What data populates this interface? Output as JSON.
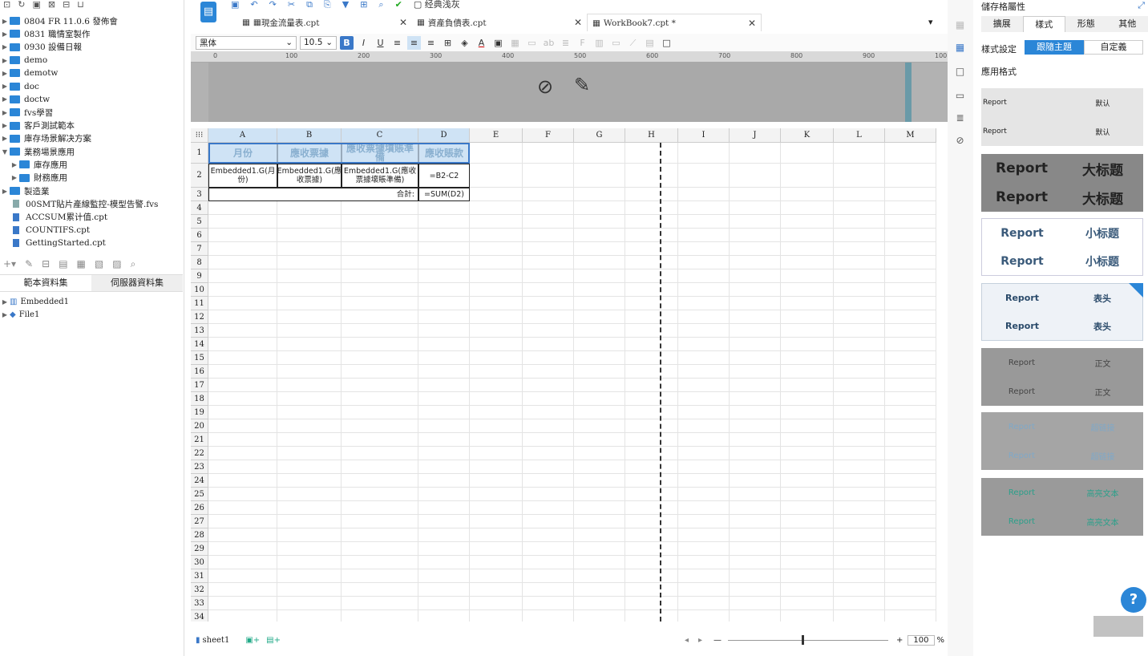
{
  "left_panel": {
    "tree": [
      {
        "label": "0804 FR 11.0.6 發佈會",
        "type": "folder"
      },
      {
        "label": "0831 職情室製作",
        "type": "folder"
      },
      {
        "label": "0930 設備日報",
        "type": "folder"
      },
      {
        "label": "demo",
        "type": "folder"
      },
      {
        "label": "demotw",
        "type": "folder"
      },
      {
        "label": "doc",
        "type": "folder"
      },
      {
        "label": "doctw",
        "type": "folder"
      },
      {
        "label": "fvs學習",
        "type": "folder"
      },
      {
        "label": "客戶測試範本",
        "type": "folder"
      },
      {
        "label": "庫存场景解决方案",
        "type": "folder"
      },
      {
        "label": "業務場景應用",
        "type": "folder-open"
      },
      {
        "label": "庫存應用",
        "type": "subfolder"
      },
      {
        "label": "財務應用",
        "type": "subfolder"
      },
      {
        "label": "製造業",
        "type": "folder"
      },
      {
        "label": "00SMT貼片產線監控-模型告警.fvs",
        "type": "file"
      },
      {
        "label": "ACCSUM累计值.cpt",
        "type": "file"
      },
      {
        "label": "COUNTIFS.cpt",
        "type": "file"
      },
      {
        "label": "GettingStarted.cpt",
        "type": "file"
      }
    ],
    "dataset_tabs": [
      "範本資料集",
      "伺服器資料集"
    ],
    "datasets": [
      "Embedded1",
      "File1"
    ]
  },
  "toolbar": {
    "theme_label": "经典浅灰",
    "font": "黑体",
    "size": "10.5"
  },
  "tabs": [
    {
      "label": "現金流量表.cpt"
    },
    {
      "label": "資產負債表.cpt"
    },
    {
      "label": "WorkBook7.cpt *"
    }
  ],
  "ruler_ticks": [
    "0",
    "100",
    "200",
    "300",
    "400",
    "500",
    "600",
    "700",
    "800",
    "900",
    "100"
  ],
  "sheet": {
    "columns": [
      "A",
      "B",
      "C",
      "D",
      "E",
      "F",
      "G",
      "H",
      "I",
      "J",
      "K",
      "L",
      "M"
    ],
    "headers": [
      "月份",
      "應收票據",
      "應收票據墳賬準備",
      "應收賬款"
    ],
    "row2": [
      "Embedded1.G(月份)",
      "Embedded1.G(應收票據)",
      "Embedded1.G(應收票據壞賬準備)",
      "=B2-C2"
    ],
    "row3_label": "合計:",
    "row3_value": "=SUM(D2)"
  },
  "bottom": {
    "sheet_name": "sheet1",
    "zoom": "100",
    "zoom_unit": "%"
  },
  "right_panel": {
    "title": "儲存格屬性",
    "tabs": [
      "擴展",
      "樣式",
      "形態",
      "其他"
    ],
    "style_setting_label": "樣式設定",
    "follow_theme": "跟隨主題",
    "custom": "自定義",
    "apply_format": "應用格式",
    "tiles": [
      {
        "a": "Report",
        "b": "默认"
      },
      {
        "a": "Report",
        "b": "大标题"
      },
      {
        "a": "Report",
        "b": "小标题"
      },
      {
        "a": "Report",
        "b": "表头"
      },
      {
        "a": "Report",
        "b": "正文"
      },
      {
        "a": "Report",
        "b": "超链接"
      },
      {
        "a": "Report",
        "b": "高亮文本"
      }
    ],
    "help": "?"
  }
}
